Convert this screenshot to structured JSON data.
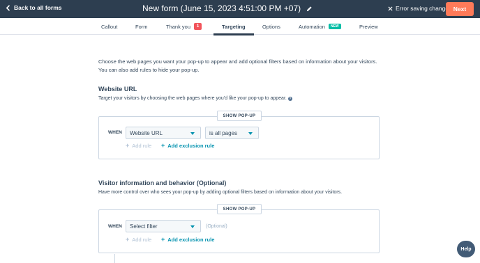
{
  "header": {
    "back_label": "Back to all forms",
    "title": "New form (June 15, 2023 4:51:00 PM +07)",
    "edit_icon": "pencil-icon",
    "error_label": "Error saving changes",
    "next_label": "Next",
    "colors": {
      "bar": "#2d3e50",
      "next": "#ff7a59"
    }
  },
  "tabs": [
    {
      "label": "Callout"
    },
    {
      "label": "Form"
    },
    {
      "label": "Thank you",
      "badge": "1"
    },
    {
      "label": "Targeting",
      "active": true
    },
    {
      "label": "Options"
    },
    {
      "label": "Automation",
      "badge": "NEW"
    },
    {
      "label": "Preview"
    }
  ],
  "intro": "Choose the web pages you want your pop-up to appear and add optional filters based on information about your visitors. You can also add rules to hide your pop-up.",
  "website_url": {
    "title": "Website URL",
    "description": "Target your visitors by choosing the web pages where you'd like your pop-up to appear.",
    "pill": "SHOW POP-UP",
    "when": "WHEN",
    "select_1": "Website URL",
    "select_2": "is all pages",
    "add_rule": "Add rule",
    "add_exclusion": "Add exclusion rule"
  },
  "visitor": {
    "title": "Visitor information and behavior (Optional)",
    "description": "Have more control over who sees your pop-up by adding optional filters based on information about your visitors.",
    "pill": "SHOW POP-UP",
    "when": "WHEN",
    "select_1": "Select filter",
    "optional": "(Optional)",
    "add_rule": "Add rule",
    "add_exclusion": "Add exclusion rule"
  },
  "help_label": "Help",
  "accent_color": "#0091ae"
}
